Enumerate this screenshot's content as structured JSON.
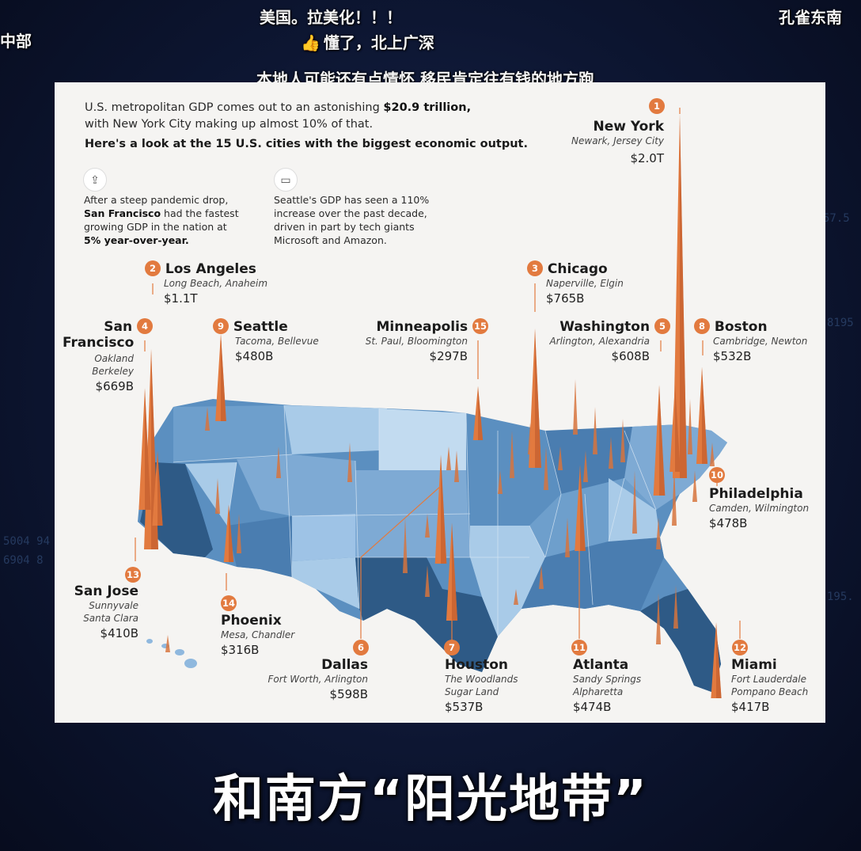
{
  "danmaku": [
    {
      "text": "美国。拉美化！！！",
      "id": "d1"
    },
    {
      "text": "懂了，北上广深",
      "id": "d2"
    },
    {
      "text": "本地人可能还有点情怀  移民肯定往有钱的地方跑",
      "id": "d3"
    },
    {
      "text": "中部",
      "id": "d4"
    },
    {
      "text": "孔雀东南",
      "id": "d5"
    }
  ],
  "bg_numbers": [
    "57.5",
    "8195",
    "195.",
    "8195",
    "5004 94",
    "6904 8"
  ],
  "intro": {
    "line1_a": "U.S. metropolitan GDP comes out to an astonishing ",
    "line1_b": "$20.9 trillion,",
    "line2": "with New York City making up almost 10% of that.",
    "line3": "Here's a look at the 15 U.S. cities with the biggest economic output."
  },
  "facts": {
    "sf": {
      "a": "After a steep pandemic drop,",
      "b": "San Francisco",
      "c": " had the fastest",
      "d": "growing GDP in the nation at",
      "e": "5% year-over-year."
    },
    "seattle": {
      "a": "Seattle's GDP has seen a 110%",
      "b": "increase over the past decade,",
      "c": "driven in part by tech giants",
      "d": "Microsoft and Amazon."
    }
  },
  "cities": [
    {
      "rank": "1",
      "name": "New York",
      "sub1": "Newark, Jersey City",
      "sub2": "",
      "value": "$2.0T"
    },
    {
      "rank": "2",
      "name": "Los Angeles",
      "sub1": "Long Beach, Anaheim",
      "sub2": "",
      "value": "$1.1T"
    },
    {
      "rank": "3",
      "name": "Chicago",
      "sub1": "Naperville, Elgin",
      "sub2": "",
      "value": "$765B"
    },
    {
      "rank": "4",
      "name": "San",
      "name2": "Francisco",
      "sub1": "Oakland",
      "sub2": "Berkeley",
      "value": "$669B"
    },
    {
      "rank": "5",
      "name": "Washington",
      "sub1": "Arlington, Alexandria",
      "sub2": "",
      "value": "$608B"
    },
    {
      "rank": "6",
      "name": "Dallas",
      "sub1": "Fort Worth, Arlington",
      "sub2": "",
      "value": "$598B"
    },
    {
      "rank": "7",
      "name": "Houston",
      "sub1": "The Woodlands",
      "sub2": "Sugar Land",
      "value": "$537B"
    },
    {
      "rank": "8",
      "name": "Boston",
      "sub1": "Cambridge, Newton",
      "sub2": "",
      "value": "$532B"
    },
    {
      "rank": "9",
      "name": "Seattle",
      "sub1": "Tacoma, Bellevue",
      "sub2": "",
      "value": "$480B"
    },
    {
      "rank": "10",
      "name": "Philadelphia",
      "sub1": "Camden, Wilmington",
      "sub2": "",
      "value": "$478B"
    },
    {
      "rank": "11",
      "name": "Atlanta",
      "sub1": "Sandy Springs",
      "sub2": "Alpharetta",
      "value": "$474B"
    },
    {
      "rank": "12",
      "name": "Miami",
      "sub1": "Fort Lauderdale",
      "sub2": "Pompano Beach",
      "value": "$417B"
    },
    {
      "rank": "13",
      "name": "San Jose",
      "sub1": "Sunnyvale",
      "sub2": "Santa Clara",
      "value": "$410B"
    },
    {
      "rank": "14",
      "name": "Phoenix",
      "sub1": "Mesa, Chandler",
      "sub2": "",
      "value": "$316B"
    },
    {
      "rank": "15",
      "name": "Minneapolis",
      "sub1": "St. Paul,  Bloomington",
      "sub2": "",
      "value": "$297B"
    }
  ],
  "colors": {
    "spike": "#e27a3f",
    "rank_badge": "#e27a3f",
    "map_dark": "#2e5a86",
    "map_mid": "#5b8fc0",
    "map_light": "#a9cbe8"
  },
  "subtitle": "和南方“阳光地带”"
}
